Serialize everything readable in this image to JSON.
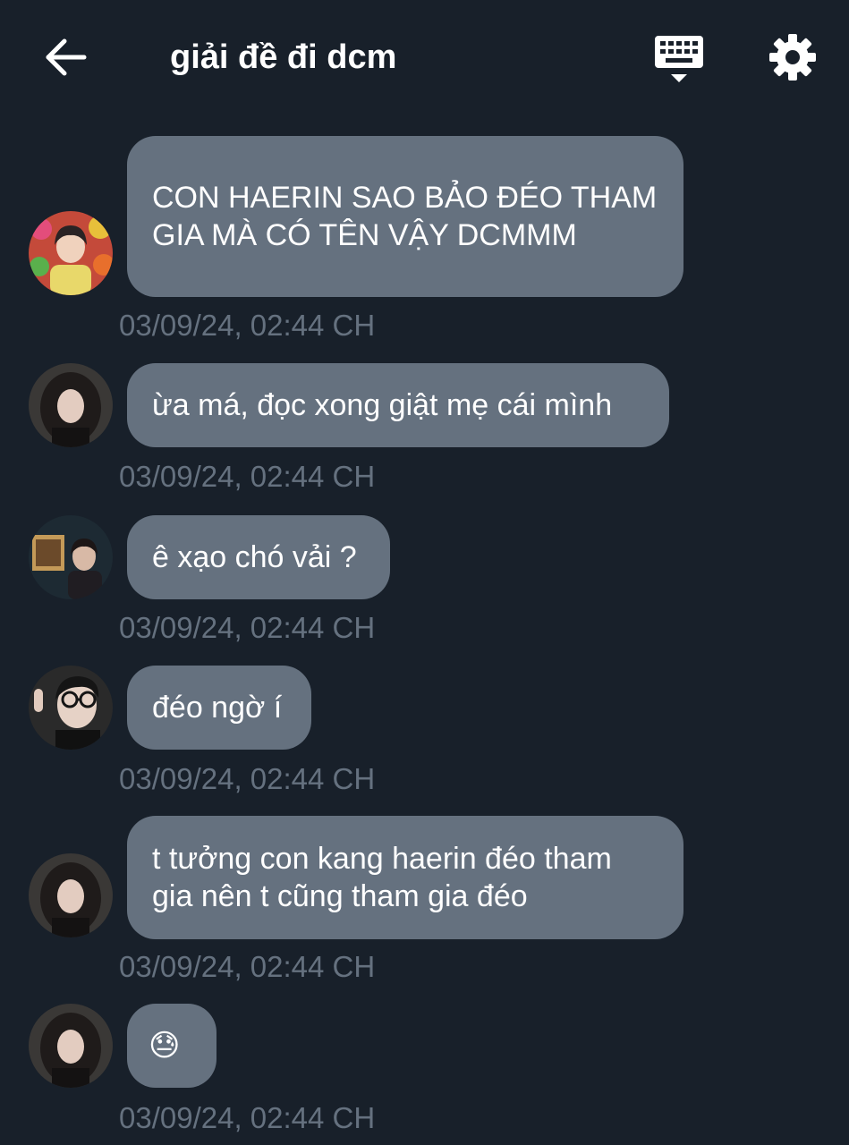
{
  "header": {
    "title": "giải đề đi dcm",
    "back_icon": "arrow-left-icon",
    "keyboard_icon": "keyboard-icon",
    "settings_icon": "gear-icon"
  },
  "colors": {
    "background": "#18202a",
    "bubble": "#65717f",
    "text": "#ffffff",
    "timestamp": "#65717f"
  },
  "messages": [
    {
      "text": "CON HAERIN SAO BẢO ĐÉO THAM GIA MÀ CÓ TÊN VẬY DCMMM",
      "time": "03/09/24, 02:44 CH"
    },
    {
      "text": "ừa má, đọc xong giật mẹ cái mình",
      "time": "03/09/24, 02:44 CH"
    },
    {
      "text": "ê xạo chó vải ?",
      "time": "03/09/24, 02:44 CH"
    },
    {
      "text": "đéo ngờ í",
      "time": "03/09/24, 02:44 CH"
    },
    {
      "text": "t tưởng con kang haerin đéo tham gia nên t cũng tham gia đéo",
      "time": "03/09/24, 02:44 CH"
    },
    {
      "text": "😓",
      "time": "03/09/24, 02:44 CH"
    }
  ]
}
